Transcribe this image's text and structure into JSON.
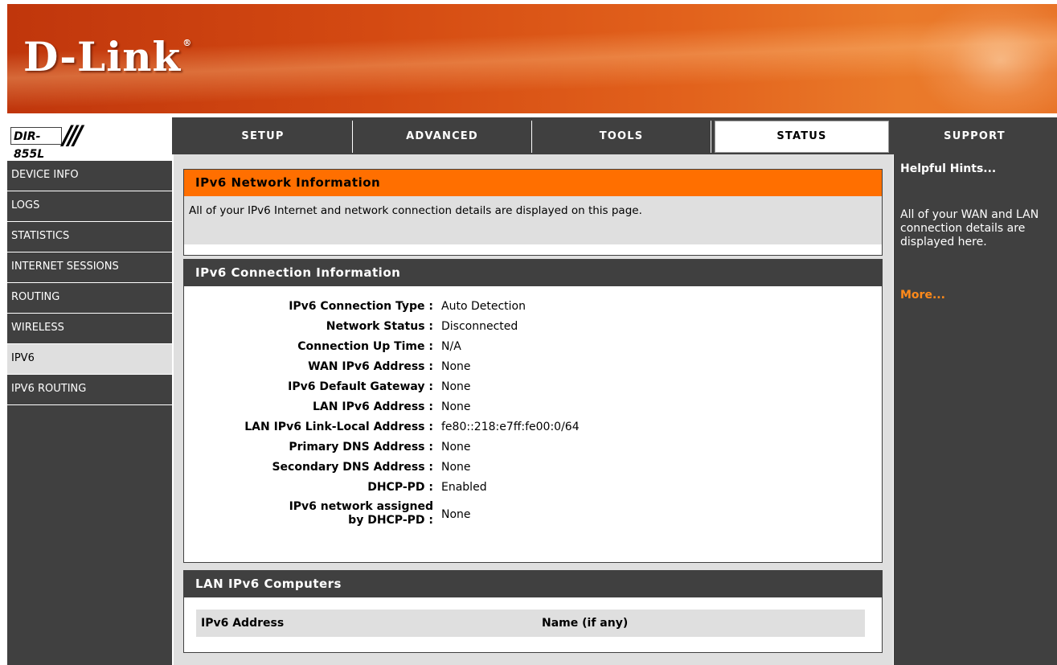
{
  "brand": {
    "logo_text": "D-Link",
    "logo_mark": "®",
    "model": "DIR-855L",
    "model_slashes": "///"
  },
  "tabs": [
    {
      "label": "SETUP",
      "active": false
    },
    {
      "label": "ADVANCED",
      "active": false
    },
    {
      "label": "TOOLS",
      "active": false
    },
    {
      "label": "STATUS",
      "active": true
    },
    {
      "label": "SUPPORT",
      "active": false
    }
  ],
  "sidebar": {
    "items": [
      {
        "label": "DEVICE INFO"
      },
      {
        "label": "LOGS"
      },
      {
        "label": "STATISTICS"
      },
      {
        "label": "INTERNET SESSIONS"
      },
      {
        "label": "ROUTING"
      },
      {
        "label": "WIRELESS"
      },
      {
        "label": "IPV6",
        "active": true
      },
      {
        "label": "IPV6 ROUTING"
      }
    ]
  },
  "network_info": {
    "title": "IPv6 Network Information",
    "description": "All of your IPv6 Internet and network connection details are displayed on this page."
  },
  "connection_info": {
    "title": "IPv6 Connection Information",
    "rows": [
      {
        "label": "IPv6 Connection Type :",
        "value": "Auto Detection"
      },
      {
        "label": "Network Status :",
        "value": "Disconnected"
      },
      {
        "label": "Connection Up Time :",
        "value": "N/A"
      },
      {
        "label": "WAN IPv6 Address :",
        "value": "None"
      },
      {
        "label": "IPv6 Default Gateway :",
        "value": "None"
      },
      {
        "label": "LAN IPv6 Address :",
        "value": "None"
      },
      {
        "label": "LAN IPv6 Link-Local Address :",
        "value": "fe80::218:e7ff:fe00:0/64"
      },
      {
        "label": "Primary DNS Address :",
        "value": "None"
      },
      {
        "label": "Secondary DNS Address :",
        "value": "None"
      },
      {
        "label": "DHCP-PD :",
        "value": "Enabled"
      }
    ],
    "pd_row": {
      "label_line1": "IPv6 network assigned",
      "label_line2": "by DHCP-PD :",
      "value": "None"
    }
  },
  "lan_computers": {
    "title": "LAN IPv6 Computers",
    "columns": [
      "IPv6 Address",
      "Name (if any)"
    ]
  },
  "hints": {
    "title": "Helpful Hints...",
    "text": "All of your WAN and LAN connection details are displayed here.",
    "more": "More..."
  },
  "colors": {
    "orange": "#ff6f00",
    "dark": "#404040",
    "light": "#dfdfdf",
    "more_link": "#ff8a1a"
  }
}
